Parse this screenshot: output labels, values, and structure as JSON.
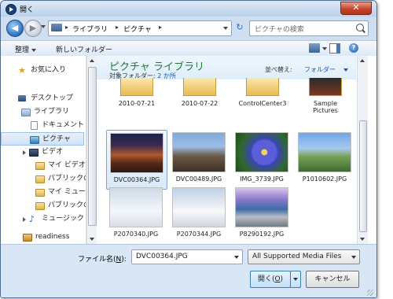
{
  "window": {
    "title": "開く",
    "close_glyph": "✕"
  },
  "address": {
    "back_glyph": "◀",
    "forward_glyph": "▶",
    "breadcrumbs": [
      "ライブラリ",
      "ピクチャ"
    ],
    "separator": "▸",
    "refresh_glyph": "↻"
  },
  "search": {
    "placeholder": "ピクチャの検索"
  },
  "toolbar": {
    "organize_label": "整理",
    "new_folder_label": "新しいフォルダー",
    "help_glyph": "?"
  },
  "nav": {
    "items": [
      {
        "label": "お気に入り",
        "icon": "star-icon"
      },
      {
        "label": "デスクトップ",
        "icon": "desktop-icon"
      },
      {
        "label": "ライブラリ",
        "icon": "library-icon"
      },
      {
        "label": "ドキュメント",
        "icon": "documents-icon"
      },
      {
        "label": "ピクチャ",
        "icon": "pictures-icon",
        "selected": true
      },
      {
        "label": "ビデオ",
        "icon": "videos-icon"
      },
      {
        "label": "マイ ビデオ",
        "icon": "folder-icon"
      },
      {
        "label": "パブリックの",
        "icon": "folder-icon"
      },
      {
        "label": "マイ ミュージ",
        "icon": "folder-icon"
      },
      {
        "label": "パブリックの",
        "icon": "folder-icon"
      },
      {
        "label": "ミュージック",
        "icon": "music-icon"
      },
      {
        "label": "readiness",
        "icon": "user-folder-icon"
      }
    ]
  },
  "library": {
    "title": "ピクチャ ライブラリ",
    "target_label": "対象フォルダー:",
    "target_count": "2 か所",
    "sort_label": "並べ替え:",
    "sort_value": "フォルダー"
  },
  "folders": [
    {
      "name": "2010-07-21"
    },
    {
      "name": "2010-07-22"
    },
    {
      "name": "ControlCenter3"
    },
    {
      "name": "Sample Pictures"
    }
  ],
  "files": [
    {
      "name": "DVC00364.JPG",
      "selected": true
    },
    {
      "name": "DVC00489.JPG"
    },
    {
      "name": "IMG_3739.JPG"
    },
    {
      "name": "P1010602.JPG"
    },
    {
      "name": "P2070340.JPG"
    },
    {
      "name": "P2070344.JPG"
    },
    {
      "name": "P8290192.JPG"
    }
  ],
  "footer": {
    "filename_label": "ファイル名(",
    "filename_hotkey": "N",
    "filename_label_end": "):",
    "filename_value": "DVC00364.JPG",
    "filter_value": "All Supported Media Files",
    "open_label": "開く(",
    "open_hotkey": "O",
    "open_label_end": ")",
    "cancel_label": "キャンセル"
  }
}
